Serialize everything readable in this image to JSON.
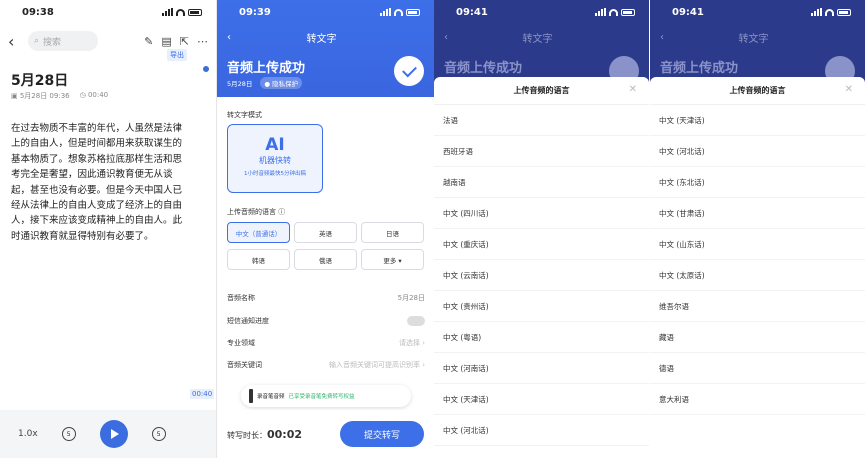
{
  "screen1": {
    "time": "09:38",
    "search_placeholder": "搜索",
    "export_badge": "导出",
    "note_title": "5月28日",
    "note_created": "5月28日 09:36",
    "note_duration": "00:40",
    "note_body": "在过去物质不丰富的年代，人虽然是法律上的自由人，但是时间都用来获取谋生的基本物质了。想象苏格拉底那样生活和思考完全是奢望，因此通识教育便无从谈起，甚至也没有必要。但是今天中国人已经从法律上的自由人变成了经济上的自由人，接下来应该变成精神上的自由人。此时通识教育就显得特别有必要了。",
    "timestamp_badge": "00:40",
    "speed": "1.0x",
    "rewind_label": "5",
    "forward_label": "5"
  },
  "screen2": {
    "time": "09:39",
    "nav_title": "转文字",
    "upload_title": "音频上传成功",
    "upload_date": "5月28日",
    "privacy_badge": "● 隐私保护",
    "mode_label": "转文字模式",
    "ai_title": "AI",
    "ai_name": "机器快转",
    "ai_desc": "1小时音频最快5分钟出稿",
    "lang_label": "上传音频的语言 ⓘ",
    "languages": [
      "中文（普通话）",
      "英语",
      "日语",
      "韩语",
      "俄语",
      "更多 ▾"
    ],
    "rows": {
      "name_label": "音频名称",
      "name_value": "5月28日",
      "sms_label": "短信通知进度",
      "domain_label": "专业领域",
      "domain_placeholder": "请选择 ›",
      "keyword_label": "音频关键词",
      "keyword_placeholder": "输入音频关键词可提高识别率 ›"
    },
    "toast_text": "录音笔音频",
    "toast_green": "已享受录音笔免费转写权益",
    "duration_label": "转写时长：",
    "duration_value": "00:02",
    "submit_label": "提交转写"
  },
  "screen3": {
    "time": "09:41",
    "nav_title": "转文字",
    "bg_title": "音频上传成功",
    "sheet_title": "上传音频的语言",
    "items": [
      "法语",
      "西班牙语",
      "越南语",
      "中文 (四川话)",
      "中文 (重庆话)",
      "中文 (云南话)",
      "中文 (贵州话)",
      "中文 (粤语)",
      "中文 (河南话)",
      "中文 (天津话)",
      "中文 (河北话)"
    ]
  },
  "screen4": {
    "time": "09:41",
    "nav_title": "转文字",
    "bg_title": "音频上传成功",
    "sheet_title": "上传音频的语言",
    "items": [
      "中文 (天津话)",
      "中文 (河北话)",
      "中文 (东北话)",
      "中文 (甘肃话)",
      "中文 (山东话)",
      "中文 (太原话)",
      "维吾尔语",
      "藏语",
      "德语",
      "意大利语"
    ]
  }
}
